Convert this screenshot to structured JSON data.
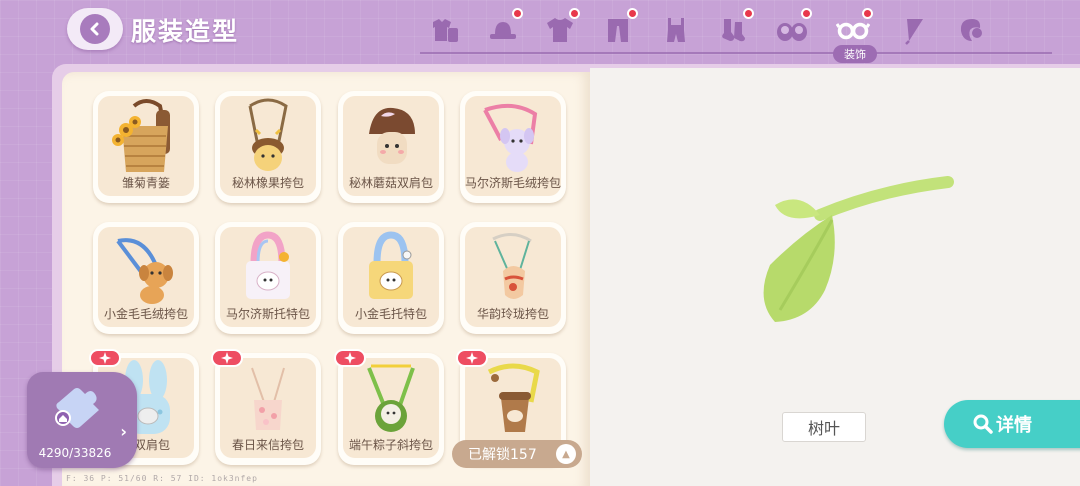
{
  "header": {
    "title": "服装造型",
    "tabs": [
      {
        "icon": "shirt-set-icon",
        "badge": false
      },
      {
        "icon": "hat-icon",
        "badge": true
      },
      {
        "icon": "tshirt-icon",
        "badge": true
      },
      {
        "icon": "pants-icon",
        "badge": true
      },
      {
        "icon": "overalls-icon",
        "badge": false
      },
      {
        "icon": "socks-icon",
        "badge": true
      },
      {
        "icon": "shoes-icon",
        "badge": true
      },
      {
        "icon": "glasses-icon",
        "badge": true
      },
      {
        "icon": "umbrella-icon",
        "badge": false
      },
      {
        "icon": "makeup-icon",
        "badge": false
      }
    ],
    "active_tab_label": "装饰"
  },
  "items": [
    {
      "name": "雏菊青篓",
      "art": "basket",
      "new": false
    },
    {
      "name": "秘林橡果挎包",
      "art": "acorn",
      "new": false
    },
    {
      "name": "秘林蘑菇双肩包",
      "art": "mushroom",
      "new": false
    },
    {
      "name": "马尔济斯毛绒挎包",
      "art": "plush-dog",
      "new": false
    },
    {
      "name": "小金毛毛绒挎包",
      "art": "golden-plush",
      "new": false
    },
    {
      "name": "马尔济斯托特包",
      "art": "tote-pink",
      "new": false
    },
    {
      "name": "小金毛托特包",
      "art": "tote-yellow",
      "new": false
    },
    {
      "name": "华韵玲珑挎包",
      "art": "pouch",
      "new": false
    },
    {
      "name": "兔双肩包",
      "art": "bunny",
      "new": true
    },
    {
      "name": "春日来信挎包",
      "art": "letter",
      "new": true
    },
    {
      "name": "端午粽子斜挎包",
      "art": "zongzi",
      "new": true
    },
    {
      "name": "",
      "art": "cup",
      "new": true
    }
  ],
  "progress": {
    "count": "4290/33826"
  },
  "unlocked": "已解锁157",
  "debug_text": "F: 36   P: 51/60   R: 57   ID: 1ok3nfep",
  "preview": {
    "item_name": "树叶"
  },
  "detail_button": "详情",
  "colors": {
    "accent": "#46cfc7",
    "theme": "#c7a2d6",
    "badge": "#ee4d62"
  }
}
